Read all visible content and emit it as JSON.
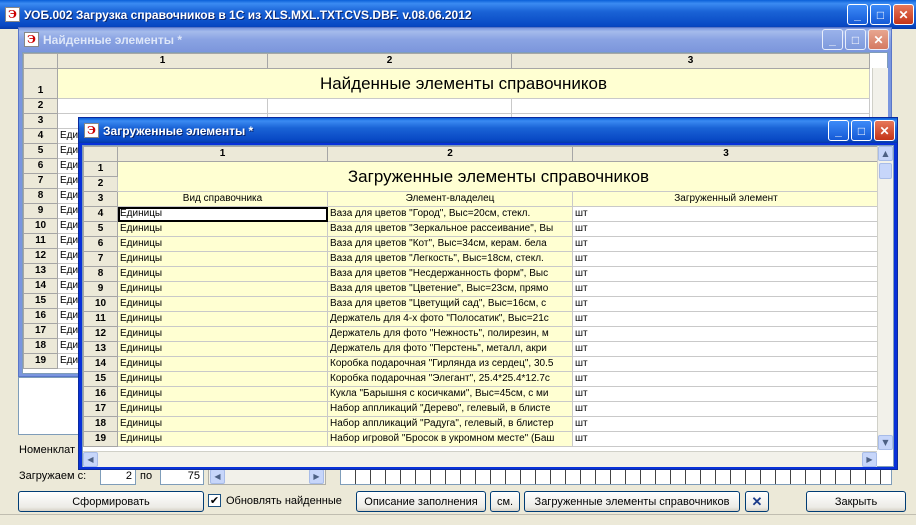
{
  "main_window": {
    "title": "УОБ.002 Загрузка справочников в 1С из XLS.MXL.TXT.CVS.DBF. v.08.06.2012",
    "min_glyph": "_",
    "max_glyph": "□",
    "close_glyph": "✕"
  },
  "found_window": {
    "title": "Найденные элементы  *",
    "columns": [
      "1",
      "2",
      "3"
    ],
    "report_title": "Найденные элементы справочников",
    "row_numbers": [
      "1",
      "2",
      "3",
      "4",
      "5",
      "6",
      "7",
      "8",
      "9",
      "10",
      "11",
      "12",
      "13",
      "14",
      "15",
      "16",
      "17",
      "18",
      "19"
    ],
    "cell_prefix": "Еди",
    "min_glyph": "_",
    "max_glyph": "□",
    "close_glyph": "✕"
  },
  "loaded_window": {
    "title": "Загруженные элементы  *",
    "columns": [
      "1",
      "2",
      "3"
    ],
    "report_title": "Загруженные элементы справочников",
    "headers": [
      "Вид справочника",
      "Элемент-владелец",
      "Загруженный элемент"
    ],
    "rows": [
      {
        "n": "4",
        "kind": "Единицы",
        "owner": "Ваза для цветов \"Город\", Выс=20см, стекл.",
        "item": "шт"
      },
      {
        "n": "5",
        "kind": "Единицы",
        "owner": "Ваза для цветов \"Зеркальное рассеивание\", Вы",
        "item": "шт"
      },
      {
        "n": "6",
        "kind": "Единицы",
        "owner": "Ваза для цветов \"Кот\", Выс=34см, керам. бела",
        "item": "шт"
      },
      {
        "n": "7",
        "kind": "Единицы",
        "owner": "Ваза для цветов \"Легкость\", Выс=18см, стекл.",
        "item": "шт"
      },
      {
        "n": "8",
        "kind": "Единицы",
        "owner": "Ваза для цветов \"Несдержанность форм\", Выс",
        "item": "шт"
      },
      {
        "n": "9",
        "kind": "Единицы",
        "owner": "Ваза для цветов \"Цветение\", Выс=23см, прямо",
        "item": "шт"
      },
      {
        "n": "10",
        "kind": "Единицы",
        "owner": "Ваза для цветов \"Цветущий сад\", Выс=16см, с",
        "item": "шт"
      },
      {
        "n": "11",
        "kind": "Единицы",
        "owner": "Держатель для 4-х фото \"Полосатик\", Выс=21с",
        "item": "шт"
      },
      {
        "n": "12",
        "kind": "Единицы",
        "owner": "Держатель для фото \"Нежность\", полирезин, м",
        "item": "шт"
      },
      {
        "n": "13",
        "kind": "Единицы",
        "owner": "Держатель для фото \"Перстень\", металл, акри",
        "item": "шт"
      },
      {
        "n": "14",
        "kind": "Единицы",
        "owner": "Коробка подарочная \"Гирлянда из сердец\", 30.5",
        "item": "шт"
      },
      {
        "n": "15",
        "kind": "Единицы",
        "owner": "Коробка подарочная \"Элегант\", 25.4*25.4*12.7с",
        "item": "шт"
      },
      {
        "n": "16",
        "kind": "Единицы",
        "owner": "Кукла \"Барышня с косичками\", Выс=45см, с ми",
        "item": "шт"
      },
      {
        "n": "17",
        "kind": "Единицы",
        "owner": "Набор аппликаций \"Дерево\", гелевый, в блисте",
        "item": "шт"
      },
      {
        "n": "18",
        "kind": "Единицы",
        "owner": "Набор аппликаций \"Радуга\", гелевый, в блистер",
        "item": "шт"
      },
      {
        "n": "19",
        "kind": "Единицы",
        "owner": "Набор игровой \"Бросок в укромном месте\" (Баш",
        "item": "шт"
      }
    ],
    "min_glyph": "_",
    "max_glyph": "□",
    "close_glyph": "✕"
  },
  "form": {
    "nomenclature_label": "Номенклат",
    "load_from_label": "Загружаем с:",
    "load_from_value": "2",
    "to_label": "по",
    "to_value": "75",
    "buttons": {
      "build": "Сформировать",
      "update_found": "Обновлять найденные",
      "fill_description": "Описание заполнения",
      "see": "см.",
      "loaded_elements": "Загруженные элементы справочников",
      "close": "Закрыть"
    },
    "update_checked": true
  },
  "colors": {
    "title_active": "#0a5fd8",
    "title_inactive": "#7a96df",
    "cell_yellow": "#ffffd2"
  }
}
